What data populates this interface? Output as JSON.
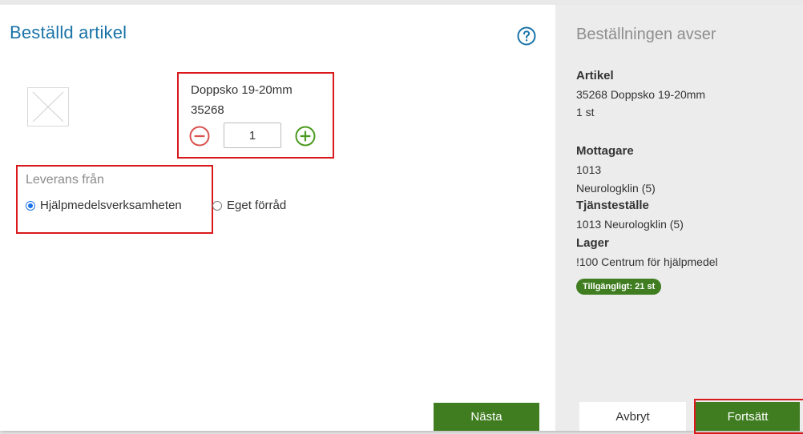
{
  "ordered_article": {
    "title": "Beställd artikel",
    "help_icon": "help-circle-icon",
    "image_icon": "image-placeholder-icon",
    "article_name": "Doppsko 19-20mm",
    "article_number": "35268",
    "quantity": "1",
    "minus_icon": "minus-circle-icon",
    "plus_icon": "plus-circle-icon",
    "delivery_from_label": "Leverans från",
    "delivery_options": [
      {
        "label": "Hjälpmedelsverksamheten",
        "checked": true
      },
      {
        "label": "Eget förråd",
        "checked": false
      }
    ],
    "next_label": "Nästa"
  },
  "summary": {
    "title": "Beställningen avser",
    "article_heading": "Artikel",
    "article_line": "35268 Doppsko 19-20mm",
    "article_qty": "1 st",
    "recipient_heading": "Mottagare",
    "recipient_code": "1013",
    "recipient_name": "Neurologklin (5)",
    "service_heading": "Tjänsteställe",
    "service_value": "1013 Neurologklin (5)",
    "stock_heading": "Lager",
    "stock_value": "!100 Centrum för hjälpmedel",
    "availability": "Tillgängligt:  21 st",
    "cancel_label": "Avbryt",
    "continue_label": "Fortsätt"
  },
  "colors": {
    "title_blue": "#1a73a8",
    "button_green": "#3f7d20",
    "highlight_red": "#d9191c",
    "minus_red": "#d9534f",
    "plus_green": "#4a9a1f"
  }
}
